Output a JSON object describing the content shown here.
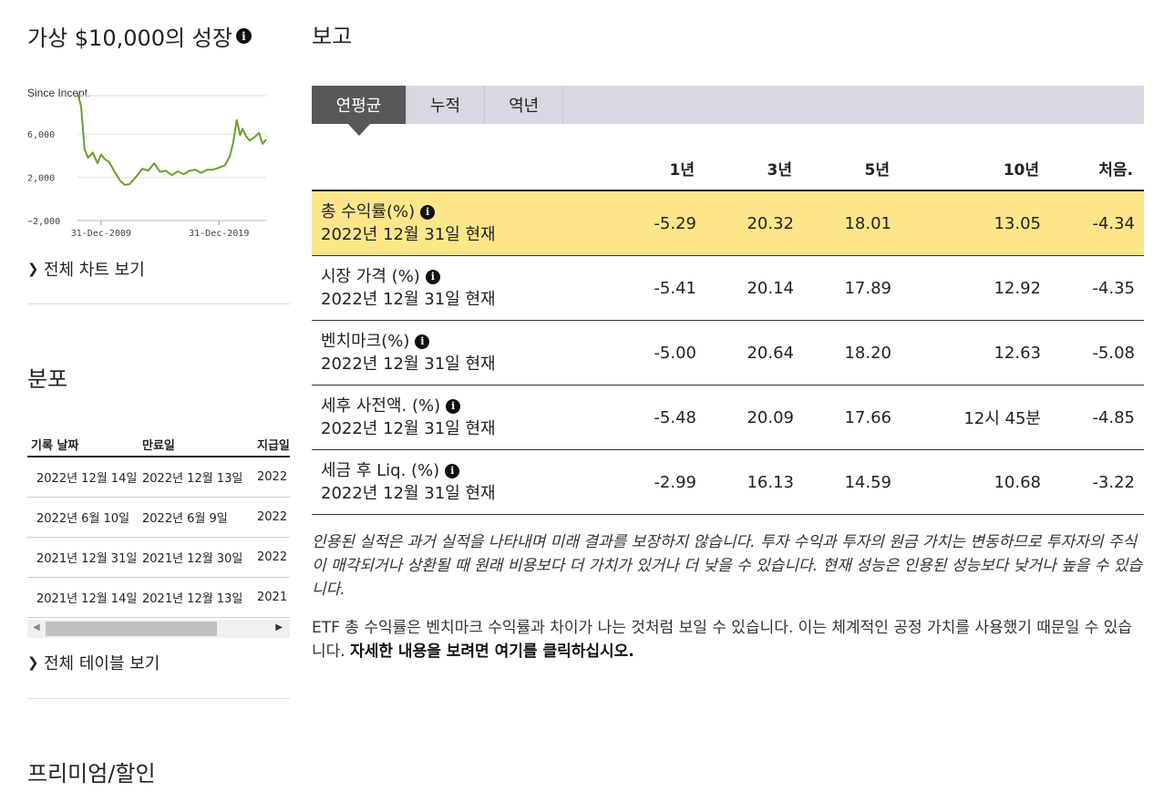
{
  "growth": {
    "title": "가상 $10,000의 성장",
    "view_full_chart": "전체 차트 보기"
  },
  "chart_data": {
    "type": "line",
    "title": "",
    "range_label": "Since Incept.",
    "yticks": [
      "6,000",
      "2,000",
      "−2,000"
    ],
    "ytick_values": [
      6000,
      2000,
      -2000
    ],
    "ylim": [
      -2000,
      9800
    ],
    "xticks": [
      "31-Dec-2009",
      "31-Dec-2019"
    ],
    "xlim": [
      2007.0,
      2023.0
    ],
    "grid": true,
    "color": "#6b9e2c",
    "series": [
      {
        "x": [
          2007.0,
          2007.3,
          2007.6,
          2007.9,
          2008.3,
          2008.7,
          2009.0,
          2009.3,
          2009.7,
          2010.1,
          2010.6,
          2011.0,
          2011.4,
          2011.7,
          2012.0,
          2012.5,
          2013.0,
          2013.5,
          2014.0,
          2014.5,
          2015.0,
          2015.5,
          2016.0,
          2016.5,
          2017.0,
          2017.5,
          2018.0,
          2018.5,
          2019.0,
          2019.5,
          2019.9,
          2020.2,
          2020.5,
          2020.8,
          2021.0,
          2021.3,
          2021.6,
          2022.0,
          2022.4,
          2022.7,
          2023.0
        ],
        "y": [
          9800,
          8600,
          4600,
          3800,
          4300,
          3300,
          4100,
          3700,
          3400,
          2600,
          1700,
          1300,
          1350,
          1700,
          2100,
          2800,
          2600,
          3300,
          2500,
          2600,
          2200,
          2550,
          2300,
          2600,
          2700,
          2400,
          2700,
          2700,
          2900,
          3100,
          3900,
          5200,
          7300,
          5900,
          6500,
          5800,
          5400,
          5700,
          6100,
          5100,
          5500
        ]
      }
    ]
  },
  "distribution": {
    "title": "분포",
    "headers": [
      "기록 날짜",
      "만료일",
      "지급일"
    ],
    "rows": [
      [
        "2022년 12월 14일",
        "2022년 12월 13일",
        "2022"
      ],
      [
        "2022년 6월 10일",
        "2022년 6월 9일",
        "2022"
      ],
      [
        "2021년 12월 31일",
        "2021년 12월 30일",
        "2022"
      ],
      [
        "2021년 12월 14일",
        "2021년 12월 13일",
        "2021"
      ]
    ],
    "view_full_table": "전체 테이블 보기"
  },
  "premium": {
    "title": "프리미엄/할인"
  },
  "performance": {
    "title": "보고",
    "tabs": [
      "연평균",
      "누적",
      "역년"
    ],
    "columns": [
      "1년",
      "3년",
      "5년",
      "10년",
      "처음."
    ],
    "rows": [
      {
        "label": "총 수익률(%)",
        "date": "2022년 12월 31일 현재",
        "values": [
          "-5.29",
          "20.32",
          "18.01",
          "13.05",
          "-4.34"
        ]
      },
      {
        "label": "시장 가격 (%)",
        "date": "2022년 12월 31일 현재",
        "values": [
          "-5.41",
          "20.14",
          "17.89",
          "12.92",
          "-4.35"
        ]
      },
      {
        "label": "벤치마크(%)",
        "date": "2022년 12월 31일 현재",
        "values": [
          "-5.00",
          "20.64",
          "18.20",
          "12.63",
          "-5.08"
        ]
      },
      {
        "label": "세후 사전액. (%)",
        "date": "2022년 12월 31일 현재",
        "values": [
          "-5.48",
          "20.09",
          "17.66",
          "12시 45분",
          "-4.85"
        ]
      },
      {
        "label": "세금 후 Liq. (%)",
        "date": "2022년 12월 31일 현재",
        "values": [
          "-2.99",
          "16.13",
          "14.59",
          "10.68",
          "-3.22"
        ]
      }
    ],
    "disclaimer": "인용된 실적은 과거 실적을 나타내며 미래 결과를 보장하지 않습니다. 투자 수익과 투자의 원금 가치는 변동하므로 투자자의 주식이 매각되거나 상환될 때 원래 비용보다 더 가치가 있거나 더 낮을 수 있습니다. 현재 성능은 인용된 성능보다 낮거나 높을 수 있습니다.",
    "etf_note": "ETF 총 수익률은 벤치마크 수익률과 차이가 나는 것처럼 보일 수 있습니다. 이는 체계적인 공정 가치를 사용했기 때문일 수 있습니다.",
    "etf_link": "자세한 내용을 보려면 여기를 클릭하십시오."
  },
  "icons": {
    "info": "info-icon",
    "chevron": "chevron-right-icon"
  }
}
